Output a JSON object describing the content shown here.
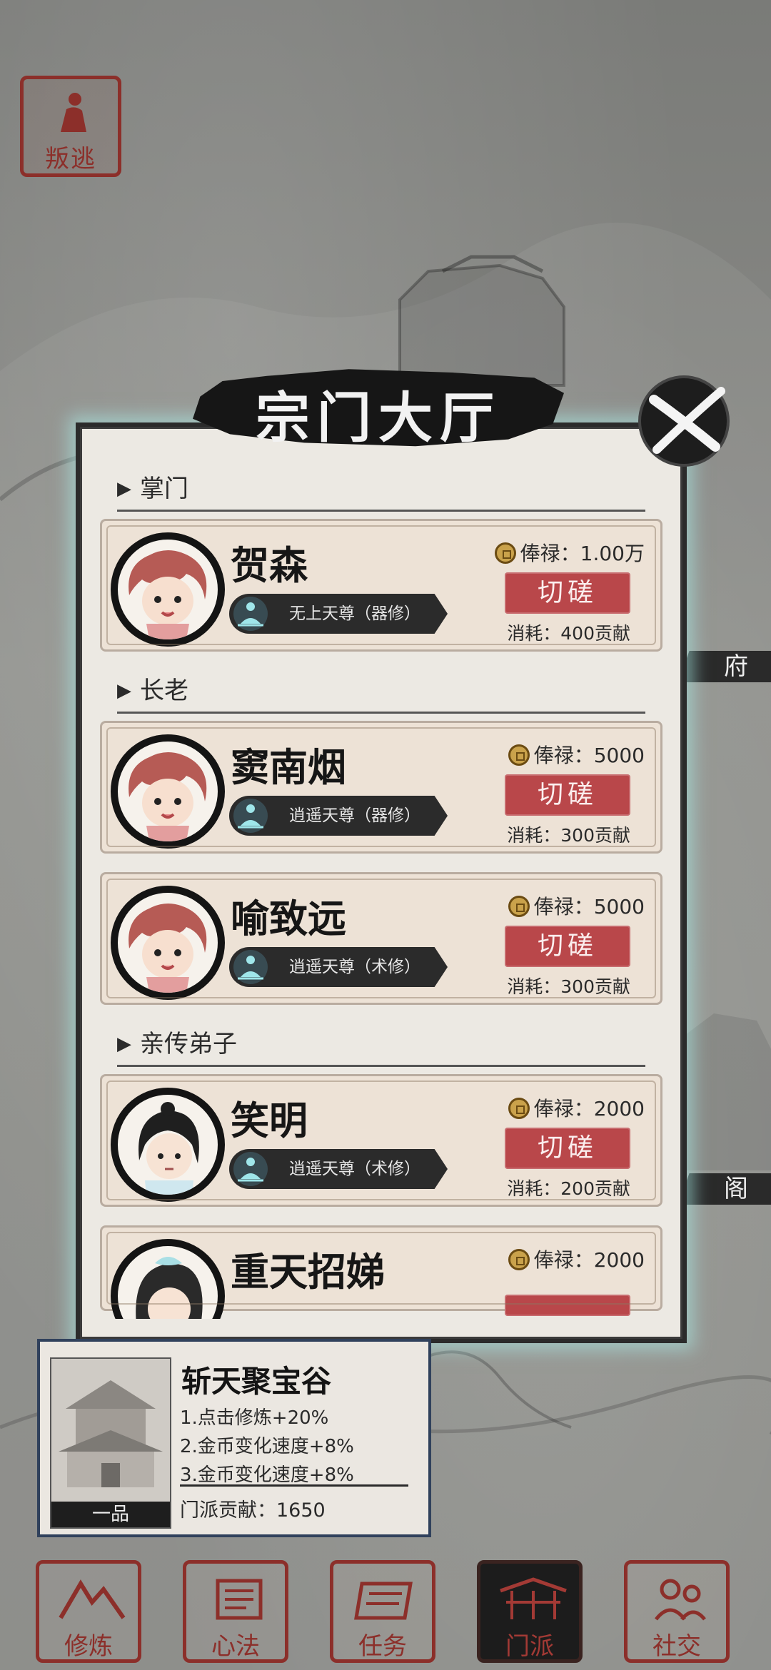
{
  "top_button": {
    "label": "叛逃"
  },
  "side_labels": [
    "府",
    "阁"
  ],
  "dialog": {
    "title": "宗门大厅",
    "sections": [
      {
        "heading": "掌门",
        "members": [
          {
            "name": "贺森",
            "rank": "无上天尊（器修）",
            "salary_label": "俸禄：",
            "salary": "1.00万",
            "action": "切磋",
            "cost": "消耗：400贡献",
            "avatar": "red-hair-girl"
          }
        ]
      },
      {
        "heading": "长老",
        "members": [
          {
            "name": "窦南烟",
            "rank": "逍遥天尊（器修）",
            "salary_label": "俸禄：",
            "salary": "5000",
            "action": "切磋",
            "cost": "消耗：300贡献",
            "avatar": "red-hair-girl"
          },
          {
            "name": "喻致远",
            "rank": "逍遥天尊（术修）",
            "salary_label": "俸禄：",
            "salary": "5000",
            "action": "切磋",
            "cost": "消耗：300贡献",
            "avatar": "red-hair-girl"
          }
        ]
      },
      {
        "heading": "亲传弟子",
        "members": [
          {
            "name": "笑明",
            "rank": "逍遥天尊（术修）",
            "salary_label": "俸禄：",
            "salary": "2000",
            "action": "切磋",
            "cost": "消耗：200贡献",
            "avatar": "black-hair-boy"
          },
          {
            "name": "重天招娣",
            "salary_label": "俸禄：",
            "salary": "2000",
            "avatar": "black-hair-girl"
          }
        ]
      }
    ]
  },
  "sect_info": {
    "name": "斩天聚宝谷",
    "grade": "一品",
    "bonuses": [
      "1.点击修炼+20%",
      "2.金币变化速度+8%",
      "3.金币变化速度+8%"
    ],
    "contribution": "门派贡献：1650"
  },
  "bottom_nav": [
    {
      "label": "修炼",
      "icon": "mountain-icon",
      "active": false
    },
    {
      "label": "心法",
      "icon": "scroll-icon",
      "active": false
    },
    {
      "label": "任务",
      "icon": "task-scroll-icon",
      "active": false
    },
    {
      "label": "门派",
      "icon": "sect-gate-icon",
      "active": true
    },
    {
      "label": "社交",
      "icon": "people-icon",
      "active": false
    }
  ],
  "colors": {
    "seal_red": "#8c2f2a",
    "spar_button": "#b9474a",
    "panel_bg": "#ece9e3",
    "card_bg": "#ede2d6",
    "glow": "#aaebe6"
  }
}
